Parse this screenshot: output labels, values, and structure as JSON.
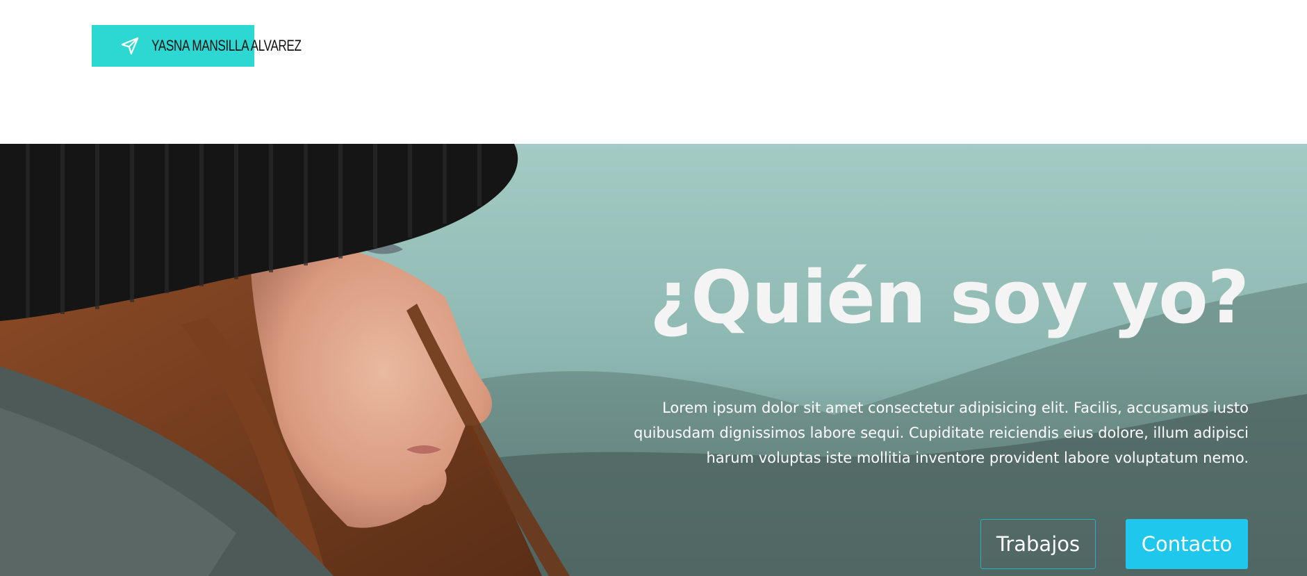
{
  "header": {
    "logo": {
      "icon": "navigation-arrow-icon",
      "text": "YASNA MANSILLA ALVAREZ",
      "accent": "#2ed8d2"
    }
  },
  "hero": {
    "title": "¿Quién soy yo?",
    "text": "Lorem ipsum dolor sit amet consectetur adipisicing elit. Facilis, accusamus iusto quibusdam dignissimos labore sequi. Cupiditate reiciendis eius dolore, illum adipisci harum voluptas iste mollitia inventore provident labore voluptatum nemo.",
    "buttons": {
      "primary_label": "Trabajos",
      "secondary_label": "Contacto"
    },
    "colors": {
      "button_outline": "#21b3c6",
      "button_solid": "#1fc7ec"
    },
    "image": "photo-woman-in-black-beanie-profile-mountain-background"
  }
}
